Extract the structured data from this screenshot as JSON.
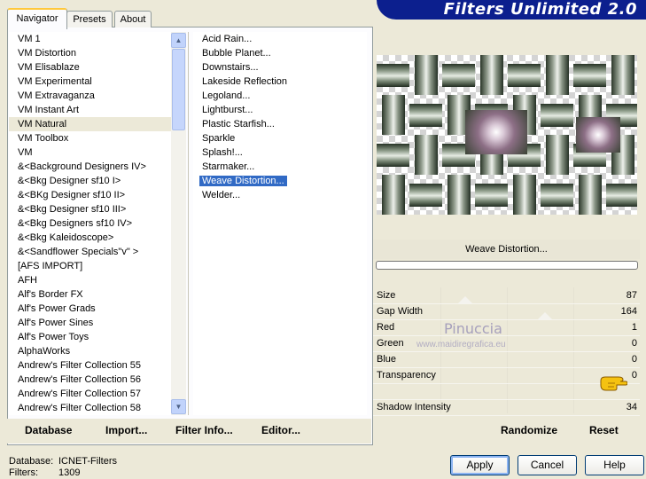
{
  "banner": {
    "title": "Filters Unlimited 2.0"
  },
  "tabs": [
    {
      "label": "Navigator",
      "active": true
    },
    {
      "label": "Presets",
      "active": false
    },
    {
      "label": "About",
      "active": false
    }
  ],
  "categories": {
    "selected": "VM Natural",
    "items": [
      "VM 1",
      "VM Distortion",
      "VM Elisablaze",
      "VM Experimental",
      "VM Extravaganza",
      "VM Instant Art",
      "VM Natural",
      "VM Toolbox",
      "VM",
      "&<Background Designers IV>",
      "&<Bkg Designer sf10 I>",
      "&<BKg Designer sf10 II>",
      "&<Bkg Designer sf10 III>",
      "&<Bkg Designers sf10 IV>",
      "&<Bkg Kaleidoscope>",
      "&<Sandflower Specials\"v\" >",
      "[AFS IMPORT]",
      "AFH",
      "Alf's Border FX",
      "Alf's Power Grads",
      "Alf's Power Sines",
      "Alf's Power Toys",
      "AlphaWorks",
      "Andrew's Filter Collection 55",
      "Andrew's Filter Collection 56",
      "Andrew's Filter Collection 57",
      "Andrew's Filter Collection 58"
    ]
  },
  "filters": {
    "selected": "Weave Distortion...",
    "items": [
      "Acid Rain...",
      "Bubble Planet...",
      "Downstairs...",
      "Lakeside Reflection",
      "Legoland...",
      "Lightburst...",
      "Plastic Starfish...",
      "Sparkle",
      "Splash!...",
      "Starmaker...",
      "Weave Distortion...",
      "Welder..."
    ]
  },
  "left_buttons": {
    "database": "Database",
    "import": "Import...",
    "filter_info": "Filter Info...",
    "editor": "Editor..."
  },
  "preview": {
    "filter_name": "Weave Distortion..."
  },
  "params": [
    {
      "label": "Size",
      "value": "87"
    },
    {
      "label": "Gap Width",
      "value": "164"
    },
    {
      "label": "Red",
      "value": "1"
    },
    {
      "label": "Green",
      "value": "0"
    },
    {
      "label": "Blue",
      "value": "0"
    },
    {
      "label": "Transparency",
      "value": "0"
    },
    {
      "label": "",
      "value": ""
    },
    {
      "label": "Shadow Intensity",
      "value": "34"
    }
  ],
  "watermark": {
    "name": "Pinuccia",
    "site": "www.maidiregrafica.eu"
  },
  "right_buttons": {
    "randomize": "Randomize",
    "reset": "Reset"
  },
  "footer": {
    "database_label": "Database:",
    "database_value": "ICNET-Filters",
    "filters_label": "Filters:",
    "filters_value": "1309"
  },
  "dialog_buttons": {
    "apply": "Apply",
    "cancel": "Cancel",
    "help": "Help"
  },
  "colors": {
    "banner": "#0C1F8E",
    "selection": "#316AC5",
    "tab_highlight": "#FFC83C"
  }
}
